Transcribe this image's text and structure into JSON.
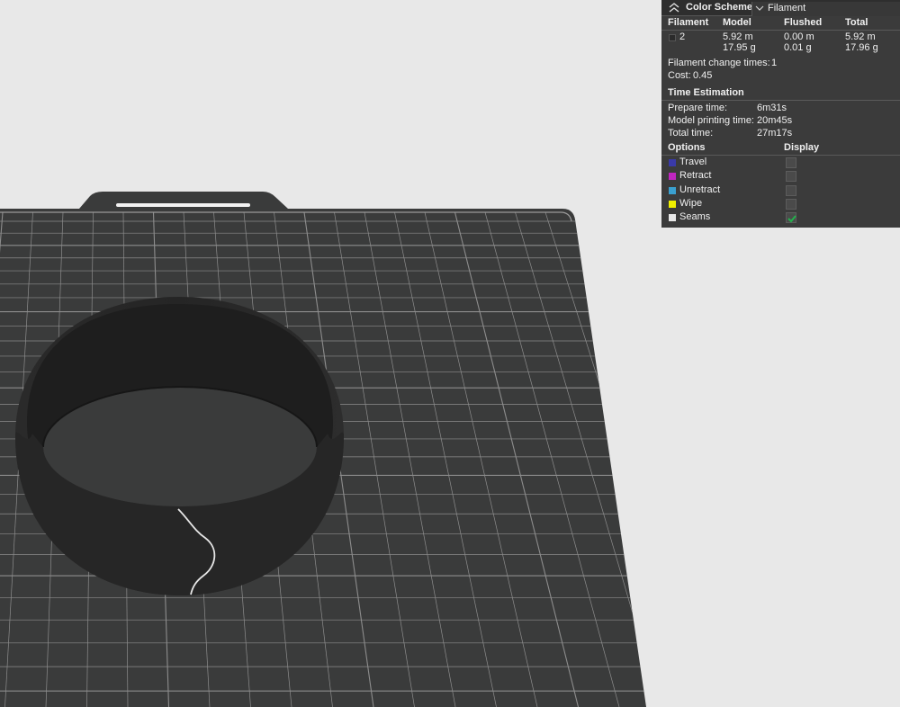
{
  "legend": {
    "title": "Color Scheme",
    "scheme_value": "Filament",
    "columns": [
      "Filament",
      "Model",
      "Flushed",
      "Total"
    ],
    "row": {
      "filament": "2",
      "swatch_color": "#2b2b2b",
      "model_len": "5.92 m",
      "model_wt": "17.95 g",
      "flushed_len": "0.00 m",
      "flushed_wt": "0.01 g",
      "total_len": "5.92 m",
      "total_wt": "17.96 g"
    },
    "change_label": "Filament change times:",
    "change_value": "1",
    "cost_label": "Cost:",
    "cost_value": "0.45",
    "time_title": "Time Estimation",
    "times": [
      {
        "label": "Prepare time:",
        "value": "6m31s"
      },
      {
        "label": "Model printing time:",
        "value": "20m45s"
      },
      {
        "label": "Total time:",
        "value": "27m17s"
      }
    ],
    "options_title": "Options",
    "display_title": "Display",
    "options": [
      {
        "label": "Travel",
        "color": "#3a3aa8",
        "checked": false
      },
      {
        "label": "Retract",
        "color": "#c026c0",
        "checked": false
      },
      {
        "label": "Unretract",
        "color": "#3aa0d0",
        "checked": false
      },
      {
        "label": "Wipe",
        "color": "#f0f000",
        "checked": false
      },
      {
        "label": "Seams",
        "color": "#e8e8e8",
        "checked": true
      }
    ]
  }
}
